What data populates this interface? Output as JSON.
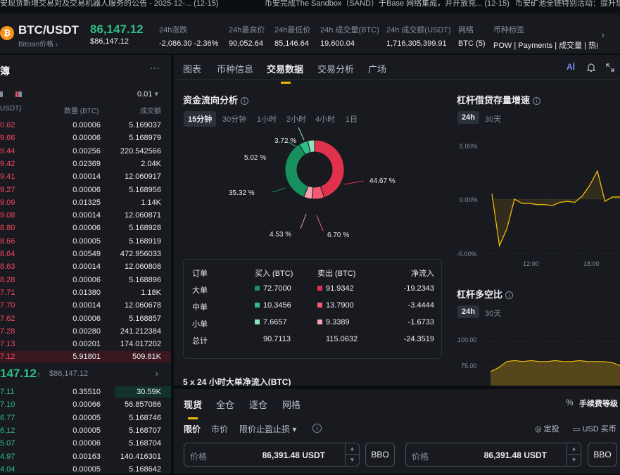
{
  "ticker": {
    "items": [
      "安现货新增交易对及交易机器人服务的公告 - 2025-12-... (12-15)",
      "币安完成The Sandbox（SAND）于Base 网络集成，并开放充... (12-15)",
      "币安矿池全链特别活动：提升您"
    ]
  },
  "header": {
    "pair": "BTC/USDT",
    "pair_sub": "Bitcoin价格 ›",
    "last_price": "86,147.12",
    "last_price_usd": "$86,147.12",
    "stats": [
      {
        "label": "24h涨跌",
        "value": "-2,086.30 -2.36%"
      },
      {
        "label": "24h最高价",
        "value": "90,052.64"
      },
      {
        "label": "24h最低价",
        "value": "85,146.64"
      },
      {
        "label": "24h 成交量(BTC)",
        "value": "19,600.04"
      },
      {
        "label": "24h 成交额(USDT)",
        "value": "1,716,305,399.91"
      },
      {
        "label": "网络",
        "value": "BTC (5)"
      },
      {
        "label": "币种标签",
        "value": "POW | Payments | 成交量 | 热门"
      }
    ]
  },
  "orderbook": {
    "title": "簿",
    "tick_size": "0.01",
    "columns": [
      "USDT)",
      "数量 (BTC)",
      "成交额"
    ],
    "asks": [
      [
        "0.62",
        "0.00006",
        "5.169037"
      ],
      [
        "9.66",
        "0.00006",
        "5.168979"
      ],
      [
        "9.44",
        "0.00256",
        "220.542566"
      ],
      [
        "9.42",
        "0.02369",
        "2.04K"
      ],
      [
        "9.41",
        "0.00014",
        "12.060917"
      ],
      [
        "9.27",
        "0.00006",
        "5.168956"
      ],
      [
        "9.09",
        "0.01325",
        "1.14K"
      ],
      [
        "9.08",
        "0.00014",
        "12.060871"
      ],
      [
        "8.80",
        "0.00006",
        "5.168928"
      ],
      [
        "8.66",
        "0.00005",
        "5.168919"
      ],
      [
        "8.64",
        "0.00549",
        "472.956033"
      ],
      [
        "8.63",
        "0.00014",
        "12.060808"
      ],
      [
        "8.28",
        "0.00006",
        "5.168896"
      ],
      [
        "7.71",
        "0.01380",
        "1.18K"
      ],
      [
        "7.70",
        "0.00014",
        "12.060678"
      ],
      [
        "7.62",
        "0.00006",
        "5.168857"
      ],
      [
        "7.28",
        "0.00280",
        "241.212384"
      ],
      [
        "7.13",
        "0.00201",
        "174.017202"
      ],
      [
        "7.12",
        "5.91801",
        "509.81K"
      ]
    ],
    "mid_price": "147.12",
    "mid_arrow": "↑",
    "mid_usd": "$86,147.12",
    "bids": [
      [
        "7.11",
        "0.35510",
        "30.59K"
      ],
      [
        "7.10",
        "0.00066",
        "56.857086"
      ],
      [
        "6.77",
        "0.00005",
        "5.168746"
      ],
      [
        "6.12",
        "0.00005",
        "5.168707"
      ],
      [
        "5.07",
        "0.00006",
        "5.168704"
      ],
      [
        "4.97",
        "0.00163",
        "140.416301"
      ],
      [
        "4.04",
        "0.00005",
        "5.168642"
      ]
    ]
  },
  "main": {
    "tabs": [
      "图表",
      "币种信息",
      "交易数据",
      "交易分析",
      "广场"
    ],
    "active_tab": "交易数据",
    "flow": {
      "title": "资金流向分析",
      "intervals": [
        "15分钟",
        "30分钟",
        "1小时",
        "2小时",
        "4小时",
        "1日"
      ],
      "selected_interval": "15分钟",
      "donut": {
        "type": "pie",
        "slices": [
          {
            "label": "44.67 %",
            "value": 44.67,
            "color": "#e0324c"
          },
          {
            "label": "6.70 %",
            "value": 6.7,
            "color": "#f25a6f"
          },
          {
            "label": "4.53 %",
            "value": 4.53,
            "color": "#f7a1ad"
          },
          {
            "label": "35.32 %",
            "value": 35.32,
            "color": "#16915d"
          },
          {
            "label": "5.02 %",
            "value": 5.02,
            "color": "#2ebd85"
          },
          {
            "label": "3.72 %",
            "value": 3.72,
            "color": "#8ee5bd"
          }
        ]
      },
      "table": {
        "headers": [
          "订单",
          "买入 (BTC)",
          "卖出 (BTC)",
          "净流入"
        ],
        "rows": [
          {
            "name": "大单",
            "buy": "72.7000",
            "sell": "91.9342",
            "net": "-19.2343",
            "buy_color": "#16915d",
            "sell_color": "#e0324c"
          },
          {
            "name": "中单",
            "buy": "10.3456",
            "sell": "13.7900",
            "net": "-3.4444",
            "buy_color": "#2ebd85",
            "sell_color": "#f25a6f"
          },
          {
            "name": "小单",
            "buy": "7.6657",
            "sell": "9.3389",
            "net": "-1.6733",
            "buy_color": "#8ee5bd",
            "sell_color": "#f7a1ad"
          },
          {
            "name": "总计",
            "buy": "90.7113",
            "sell": "115.0632",
            "net": "-24.3519"
          }
        ]
      },
      "next_title": "5 x 24 小时大单净流入(BTC)"
    },
    "margin": {
      "title": "杠杆借贷存量增速",
      "pills": [
        "24h",
        "30天"
      ],
      "selected": "24h",
      "chart_data": {
        "type": "line",
        "y_ticks": [
          "5.00%",
          "0.00%",
          "-5.00%"
        ],
        "x_ticks": [
          "12:00",
          "18:00"
        ],
        "ylim": [
          -5,
          5
        ],
        "values": [
          0.5,
          -4.3,
          -2.7,
          0.0,
          -0.4,
          -0.4,
          -0.5,
          -0.5,
          -0.6,
          -0.3,
          -0.2,
          -0.3,
          0.3,
          1.3,
          2.6,
          -0.2,
          0.2,
          0.2
        ]
      }
    },
    "longshort": {
      "title": "杠杆多空比",
      "pills": [
        "24h",
        "30天"
      ],
      "selected": "24h",
      "chart_data": {
        "type": "area",
        "y_ticks": [
          "100.00",
          "75.00"
        ],
        "values": [
          70,
          74,
          80,
          81,
          80,
          81,
          80,
          80,
          81,
          80,
          80,
          81,
          80,
          80,
          80,
          79,
          76
        ]
      }
    }
  },
  "trade": {
    "tabs": [
      "现货",
      "全仓",
      "逐仓",
      "网格"
    ],
    "active_tab": "现货",
    "fee_label": "手续费等级",
    "order_types": [
      "限价",
      "市价",
      "限价止盈止损 ▾"
    ],
    "active_order_type": "限价",
    "right_links": [
      "定投",
      "USD 买币"
    ],
    "buy_input": {
      "placeholder": "价格",
      "value": "86,391.48",
      "unit": "USDT"
    },
    "sell_input": {
      "placeholder": "价格",
      "value": "86,391.48",
      "unit": "USDT"
    },
    "bbo": "BBO"
  }
}
